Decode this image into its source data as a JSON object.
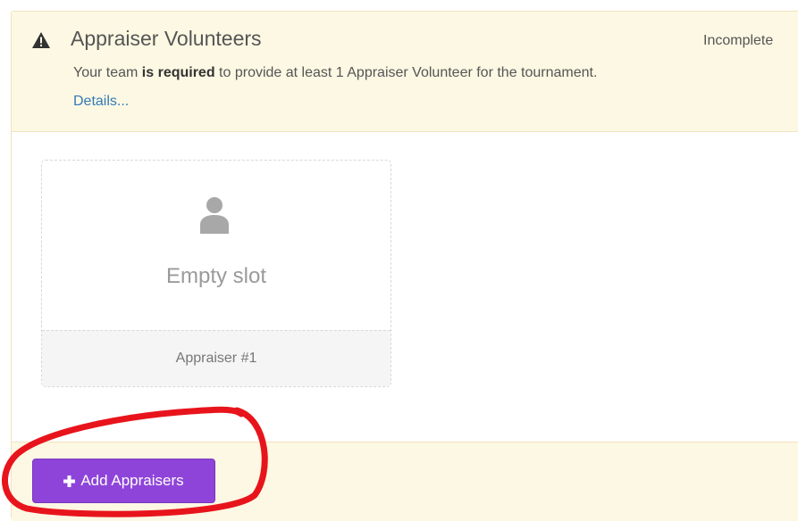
{
  "panel": {
    "title": "Appraiser Volunteers",
    "status": "Incomplete",
    "description": {
      "prefix": "Your team ",
      "emphasis": "is required",
      "suffix": " to provide at least 1 Appraiser Volunteer for the tournament."
    },
    "details_link": "Details..."
  },
  "slots": [
    {
      "empty_label": "Empty slot",
      "role_label": "Appraiser #1"
    }
  ],
  "footer": {
    "add_button_label": "Add Appraisers"
  },
  "colors": {
    "warning_bg": "#fcf8e3",
    "button_purple": "#8e44d9",
    "link_blue": "#337ab7",
    "annotation_red": "#e8141c"
  },
  "icons": [
    "warning-icon",
    "user-icon",
    "plus-icon"
  ]
}
